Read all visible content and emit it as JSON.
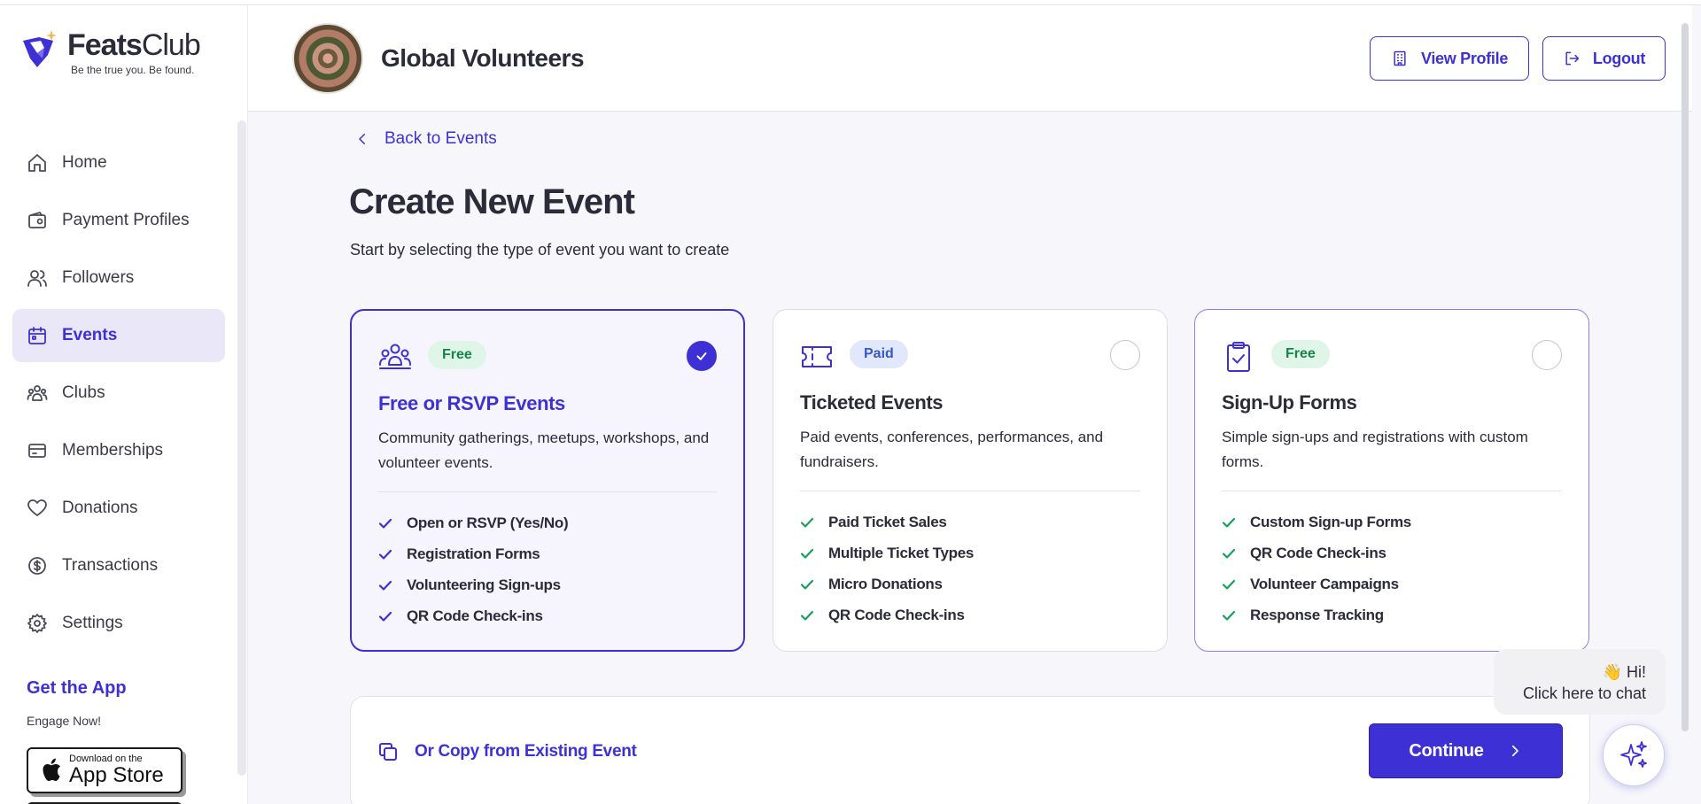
{
  "brand": {
    "name_bold": "Feats",
    "name_light": "Club",
    "tagline": "Be the true you. Be found.",
    "accent": "#3d31d6"
  },
  "sidebar": {
    "items": [
      {
        "label": "Home",
        "icon": "home-icon"
      },
      {
        "label": "Payment Profiles",
        "icon": "wallet-icon"
      },
      {
        "label": "Followers",
        "icon": "users-icon"
      },
      {
        "label": "Events",
        "icon": "calendar-icon",
        "active": true
      },
      {
        "label": "Clubs",
        "icon": "group-icon"
      },
      {
        "label": "Memberships",
        "icon": "card-icon"
      },
      {
        "label": "Donations",
        "icon": "heart-icon"
      },
      {
        "label": "Transactions",
        "icon": "dollar-icon"
      },
      {
        "label": "Settings",
        "icon": "gear-icon"
      }
    ],
    "get_app": "Get the App",
    "engage": "Engage Now!",
    "appstore_small": "Download on the",
    "appstore_big": "App Store"
  },
  "header": {
    "org_name": "Global Volunteers",
    "view_profile": "View Profile",
    "logout": "Logout"
  },
  "main": {
    "back": "Back to Events",
    "title": "Create New Event",
    "subtitle": "Start by selecting the type of event you want to create",
    "cards": [
      {
        "badge": "Free",
        "title": "Free or RSVP Events",
        "desc": "Community gatherings, meetups, workshops, and volunteer events.",
        "features": [
          "Open or RSVP (Yes/No)",
          "Registration Forms",
          "Volunteering Sign-ups",
          "QR Code Check-ins"
        ],
        "selected": true
      },
      {
        "badge": "Paid",
        "title": "Ticketed Events",
        "desc": "Paid events, conferences, performances, and fundraisers.",
        "features": [
          "Paid Ticket Sales",
          "Multiple Ticket Types",
          "Micro Donations",
          "QR Code Check-ins"
        ],
        "selected": false
      },
      {
        "badge": "Free",
        "title": "Sign-Up Forms",
        "desc": "Simple sign-ups and registrations with custom forms.",
        "features": [
          "Custom Sign-up Forms",
          "QR Code Check-ins",
          "Volunteer Campaigns",
          "Response Tracking"
        ],
        "selected": false
      }
    ],
    "copy_link": "Or Copy from Existing Event",
    "continue": "Continue"
  },
  "chat": {
    "greeting": "👋 Hi!",
    "prompt": "Click here to chat"
  }
}
